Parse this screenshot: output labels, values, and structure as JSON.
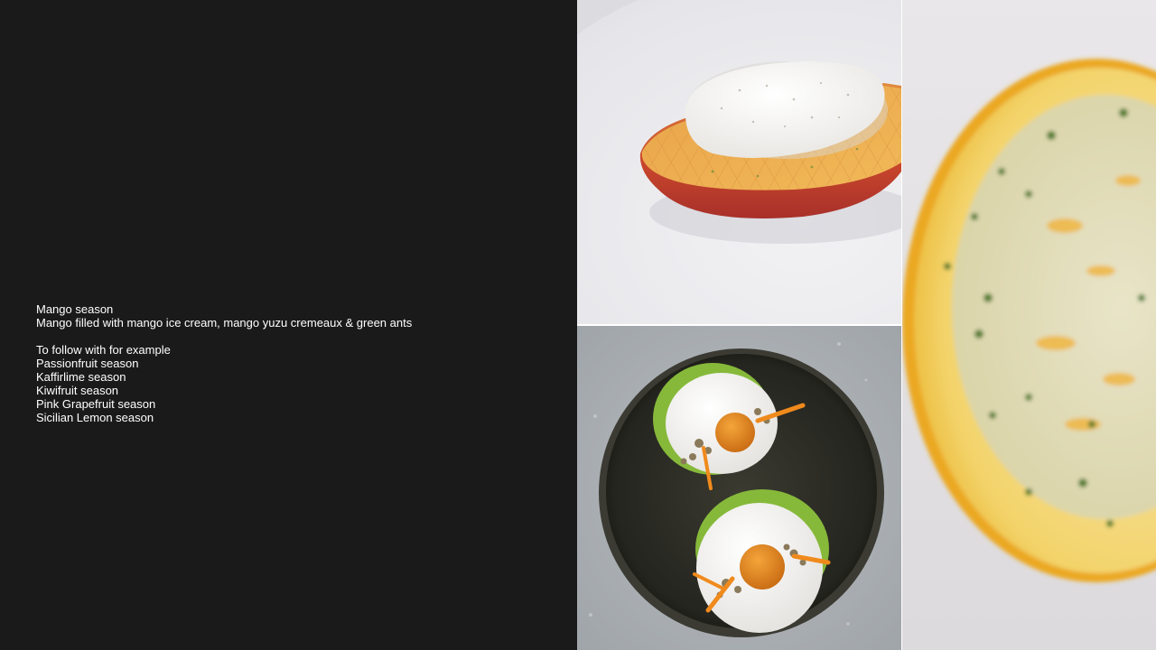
{
  "description": {
    "title": "Mango season",
    "subtitle": "Mango filled with mango ice cream, mango yuzu cremeaux & green ants",
    "follow_heading": "To follow with for example",
    "follow_items": [
      "Passionfruit season",
      "Kaffirlime season",
      "Kiwifruit season",
      "Pink Grapefruit season",
      "Sicilian Lemon season"
    ]
  },
  "colors": {
    "panel_background": "#1a1a1b",
    "text": "#ffffff"
  }
}
